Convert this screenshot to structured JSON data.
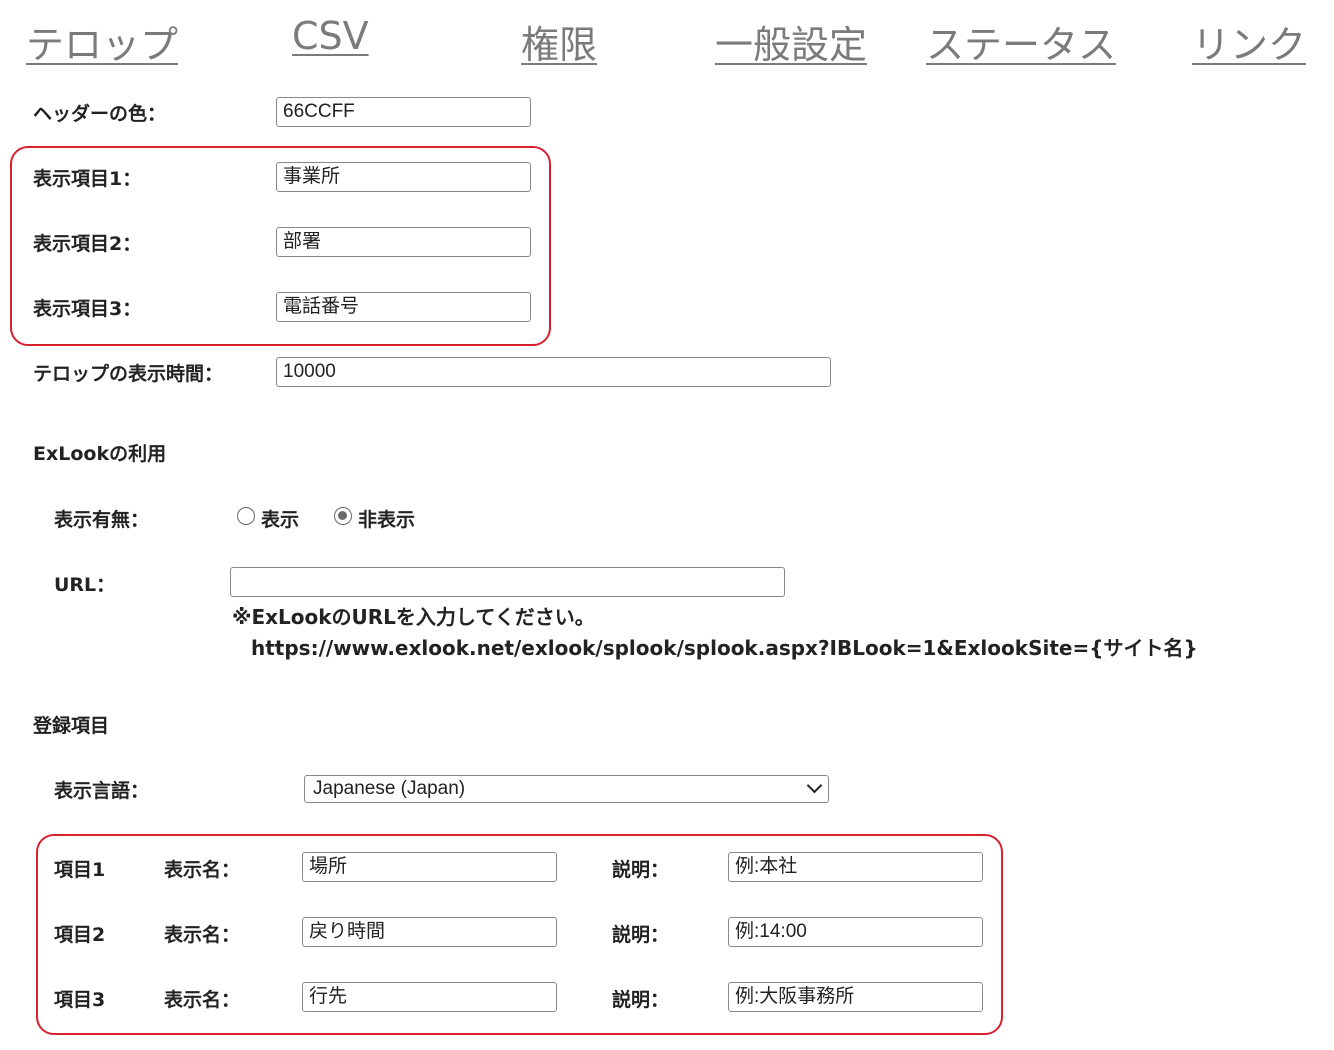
{
  "nav": {
    "items": [
      "テロップ",
      "CSV",
      "権限",
      "一般設定",
      "ステータス",
      "リンク"
    ]
  },
  "header_color": {
    "label": "ヘッダーの色：",
    "value": "66CCFF"
  },
  "display_items": [
    {
      "label": "表示項目1：",
      "value": "事業所"
    },
    {
      "label": "表示項目2：",
      "value": "部署"
    },
    {
      "label": "表示項目3：",
      "value": "電話番号"
    }
  ],
  "telop_time": {
    "label": "テロップの表示時間：",
    "value": "10000"
  },
  "exlook": {
    "section_title": "ExLookの利用",
    "show_label": "表示有無：",
    "option_show": "表示",
    "option_hide": "非表示",
    "selected": "非表示",
    "url_label": "URL：",
    "url_value": "",
    "note_line1": "※ExLookのURLを入力してください。",
    "note_line2": "https://www.exlook.net/exlook/splook/splook.aspx?IBLook=1&ExlookSite={サイト名}"
  },
  "registration": {
    "section_title": "登録項目",
    "language_label": "表示言語：",
    "language_value": "Japanese (Japan)",
    "name_label": "表示名：",
    "desc_label": "説明：",
    "items": [
      {
        "item": "項目1",
        "name": "場所",
        "desc": "例:本社"
      },
      {
        "item": "項目2",
        "name": "戻り時間",
        "desc": "例:14:00"
      },
      {
        "item": "項目3",
        "name": "行先",
        "desc": "例:大阪事務所"
      }
    ]
  },
  "colors": {
    "highlight": "#d8202e",
    "nav_text": "#7b7b7b"
  }
}
